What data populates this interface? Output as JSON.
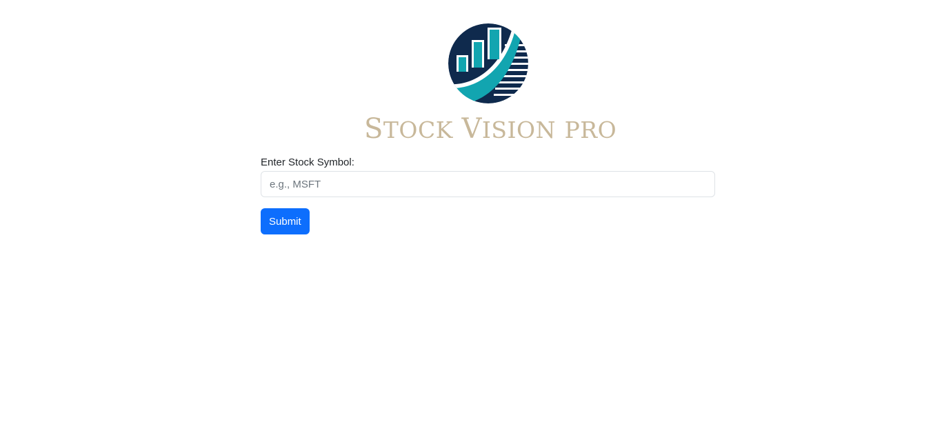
{
  "brand": {
    "logo_icon": "rising-chart-circle-icon",
    "name_part1_cap": "S",
    "name_part1_rest": "TOCK",
    "name_part2_cap": "V",
    "name_part2_rest": "ISION",
    "name_part3": "PRO",
    "color": "#c8b89a",
    "logo_navy": "#0f2a4d",
    "logo_teal": "#12a5b0"
  },
  "form": {
    "label": "Enter Stock Symbol:",
    "input_value": "",
    "input_placeholder": "e.g., MSFT",
    "submit_label": "Submit",
    "submit_color": "#0d6efd"
  }
}
